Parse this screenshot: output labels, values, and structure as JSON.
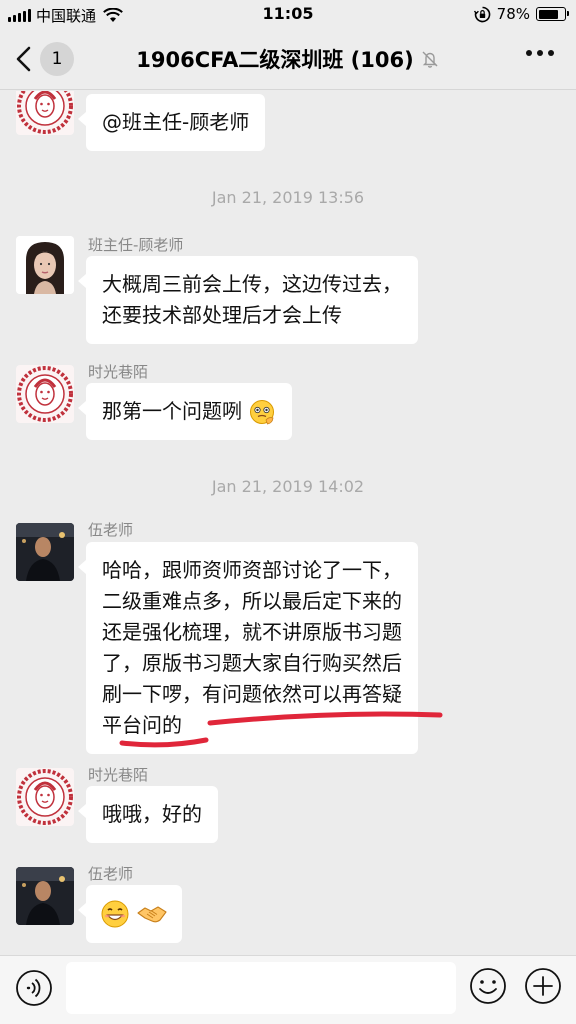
{
  "status_bar": {
    "carrier": "中国联通",
    "time": "11:05",
    "battery": "78%",
    "battery_level": 0.78,
    "icons": [
      "signal-icon",
      "wifi-icon",
      "rotation-lock-icon",
      "battery-icon"
    ]
  },
  "nav": {
    "back_icon": "chevron-left-icon",
    "unread_count": "1",
    "title": "1906CFA二级深圳班 (106)",
    "mute_icon": "bell-muted-icon",
    "more_icon": "more-dots-icon"
  },
  "messages": [
    {
      "type": "text",
      "sender": "",
      "avatar": "paper-cut-avatar",
      "lines": [
        "@班主任-顾老师"
      ]
    },
    {
      "type": "time",
      "text": "Jan 21, 2019 13:56"
    },
    {
      "type": "text",
      "sender": "班主任-顾老师",
      "avatar": "woman-avatar",
      "lines": [
        "大概周三前会上传，这边传过去，",
        "还要技术部处理后才会上传"
      ]
    },
    {
      "type": "text",
      "sender": "时光巷陌",
      "avatar": "paper-cut-avatar",
      "lines": [
        "那第一个问题咧"
      ],
      "trailing_emoji": "thinking-face-emoji"
    },
    {
      "type": "time",
      "text": "Jan 21, 2019 14:02"
    },
    {
      "type": "text",
      "sender": "伍老师",
      "avatar": "man-avatar",
      "lines": [
        "哈哈，跟师资师资部讨论了一下，",
        "二级重难点多，所以最后定下来的",
        "还是强化梳理，就不讲原版书习题",
        "了，原版书习题大家自行购买然后",
        "刷一下啰，有问题依然可以再答疑",
        "平台问的"
      ]
    },
    {
      "type": "text",
      "sender": "时光巷陌",
      "avatar": "paper-cut-avatar",
      "lines": [
        "哦哦，好的"
      ]
    },
    {
      "type": "emoji",
      "sender": "伍老师",
      "avatar": "man-avatar",
      "emojis": [
        "grin-emoji",
        "handshake-emoji"
      ]
    }
  ],
  "annotation": {
    "type": "red-hand-drawn-underline",
    "color": "#e0263a"
  },
  "input_bar": {
    "voice_icon": "voice-icon",
    "emoji_icon": "emoji-icon",
    "plus_icon": "plus-icon"
  },
  "colors": {
    "background": "#ececec",
    "bubble": "#ffffff",
    "meta_text": "#a9a9a9",
    "sender_text": "#888888"
  }
}
